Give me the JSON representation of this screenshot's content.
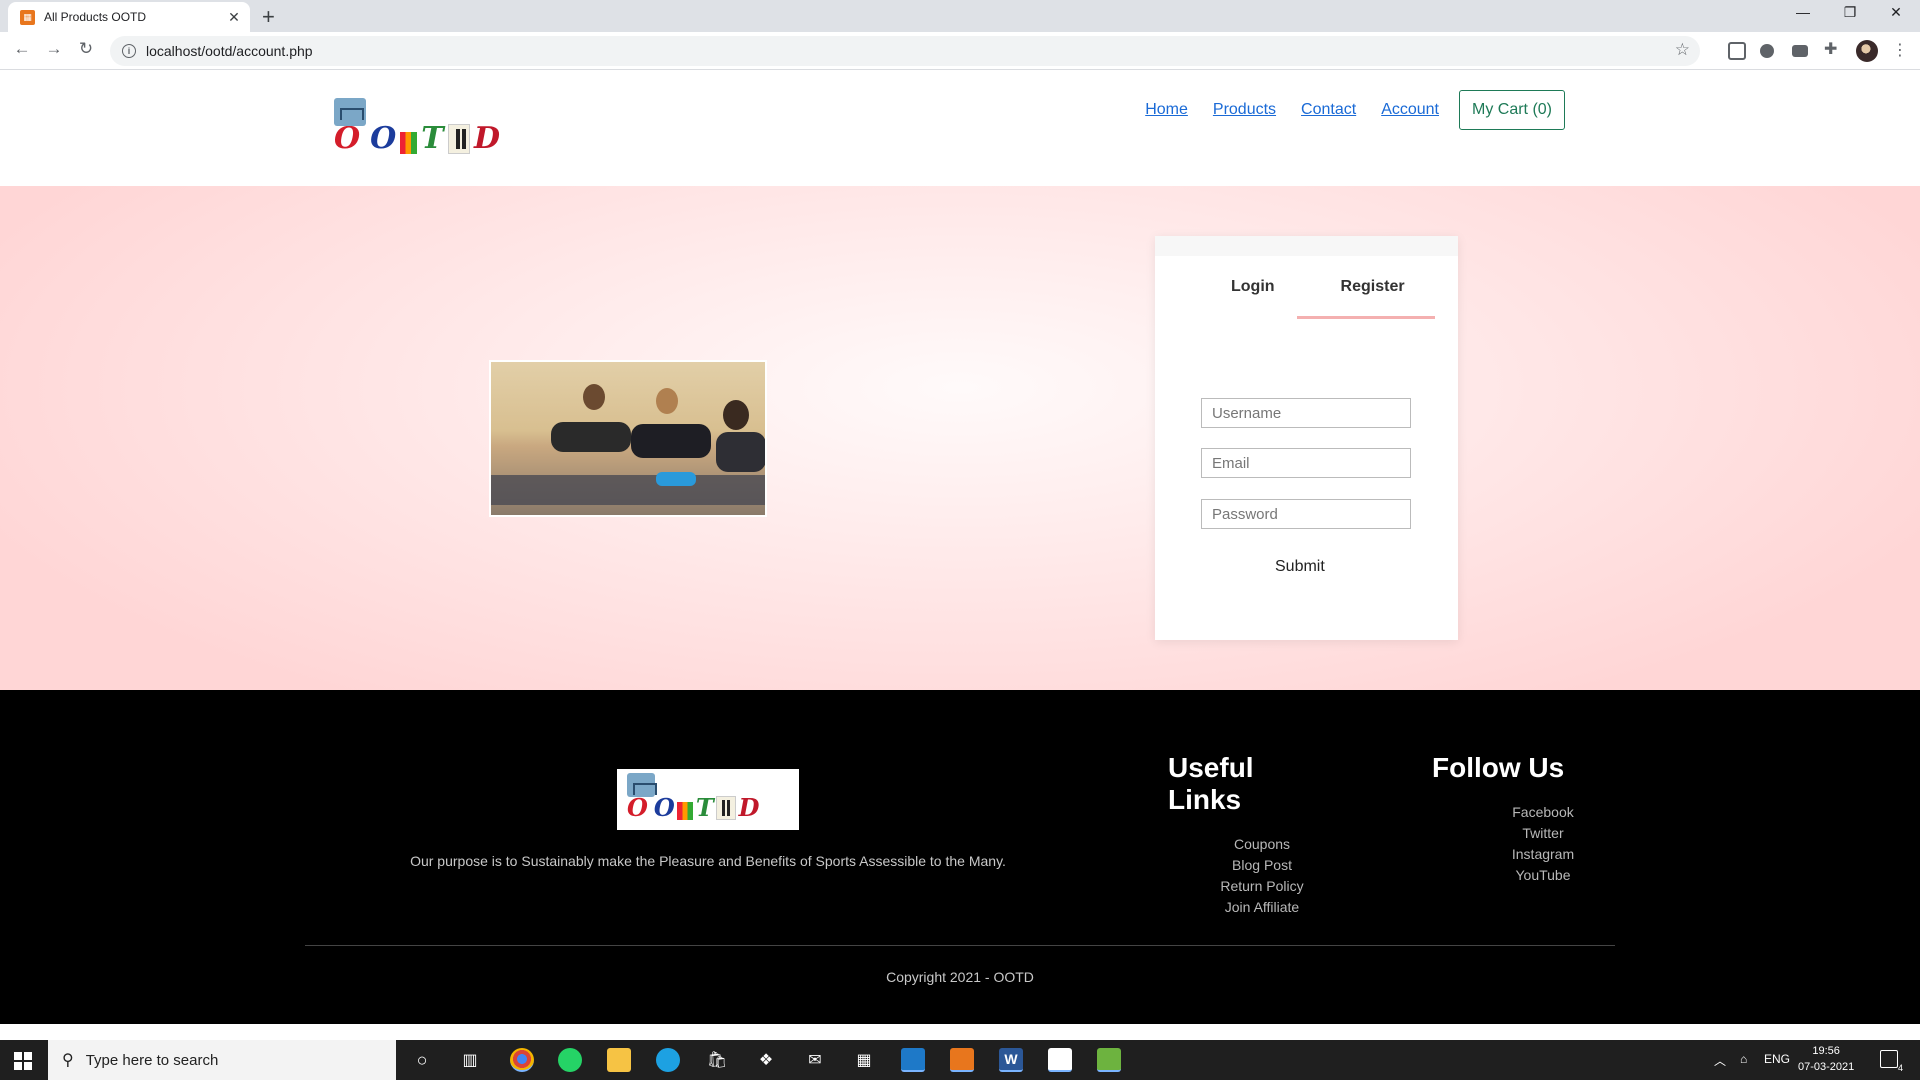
{
  "browser": {
    "tab_title": "All Products OOTD",
    "tab_close": "✕",
    "new_tab": "+",
    "url": "localhost/ootd/account.php",
    "back": "←",
    "forward": "→",
    "reload": "↻",
    "star": "☆",
    "minimize": "—",
    "maximize": "❐",
    "close": "✕",
    "menu": "⋮"
  },
  "header": {
    "logo_letters": [
      "O",
      "O",
      "T",
      "D"
    ],
    "nav": [
      "Home",
      "Products",
      "Contact",
      "Account"
    ],
    "cart": "My Cart (0)"
  },
  "form": {
    "tabs": [
      "Login",
      "Register"
    ],
    "active_tab": "Register",
    "username_placeholder": "Username",
    "email_placeholder": "Email",
    "password_placeholder": "Password",
    "submit": "Submit"
  },
  "footer": {
    "purpose": "Our purpose is to Sustainably make the Pleasure and Benefits of Sports Assessible to the Many.",
    "useful_links_heading": "Useful Links",
    "useful_links": [
      "Coupons",
      "Blog Post",
      "Return Policy",
      "Join Affiliate"
    ],
    "follow_heading": "Follow Us",
    "follow_links": [
      "Facebook",
      "Twitter",
      "Instagram",
      "YouTube"
    ],
    "copyright": "Copyright 2021 - OOTD"
  },
  "taskbar": {
    "search_placeholder": "Type here to search",
    "language": "ENG",
    "time": "19:56",
    "date": "07-03-2021",
    "notification_count": "4"
  },
  "colors": {
    "nav_link": "#1a6ad6",
    "cart_border": "#1e7a57",
    "hero_bg": "#ffd6d6",
    "footer_bg": "#000000"
  }
}
